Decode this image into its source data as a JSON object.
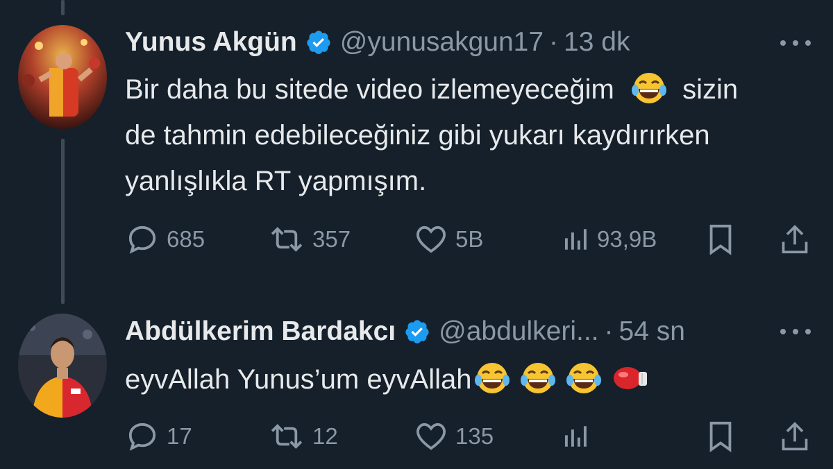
{
  "tweets": [
    {
      "name": "Yunus Akgün",
      "handle": "@yunusakgun17",
      "separator": "·",
      "time": "13 dk",
      "text_line1": "Bir daha bu sitede video izlemeyeceğim",
      "text_line1b": "sizin",
      "text_line2": "de tahmin edebileceğiniz gibi yukarı kaydırırken",
      "text_line3": "yanlışlıkla RT yapmışım.",
      "replies": "685",
      "retweets": "357",
      "likes": "5B",
      "views": "93,9B"
    },
    {
      "name": "Abdülkerim Bardakcı",
      "handle": "@abdulkeri...",
      "separator": "·",
      "time": "54 sn",
      "text": "eyvAllah Yunus’um eyvAllah",
      "replies": "17",
      "retweets": "12",
      "likes": "135",
      "views": ""
    }
  ],
  "colors": {
    "background": "#15202b",
    "text": "#e7e9ea",
    "muted": "#8b98a5",
    "verified": "#1d9bf0",
    "thread_line": "#3d4b57"
  },
  "icons": [
    "reply-icon",
    "retweet-icon",
    "like-icon",
    "views-icon",
    "bookmark-icon",
    "share-icon",
    "verified-icon",
    "more-icon",
    "laughing-emoji",
    "boxing-glove-emoji"
  ]
}
